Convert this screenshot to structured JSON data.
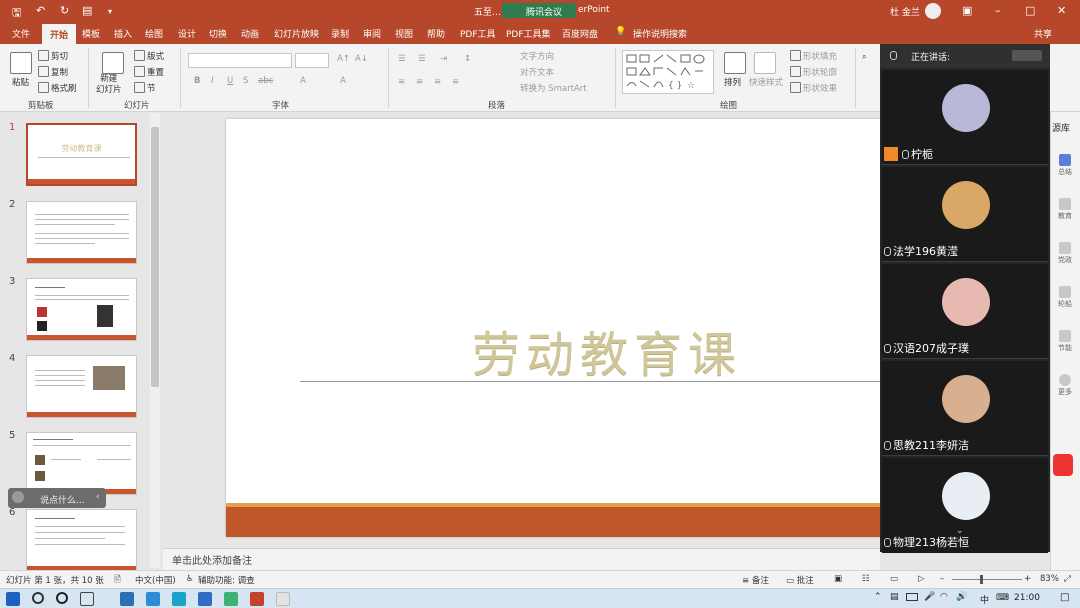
{
  "app": {
    "title": "五至…",
    "title_suffix": "erPoint",
    "meeting_app": "腾讯会议",
    "user_name": "杜 金兰",
    "share_label": "共享"
  },
  "tabs": [
    "文件",
    "开始",
    "模板",
    "插入",
    "绘图",
    "设计",
    "切换",
    "动画",
    "幻灯片放映",
    "录制",
    "审阅",
    "视图",
    "帮助",
    "PDF工具",
    "PDF工具集",
    "百度网盘"
  ],
  "active_tab": "开始",
  "search_label": "操作说明搜索",
  "ribbon": {
    "clipboard": {
      "paste": "粘贴",
      "cut": "剪切",
      "copy": "复制",
      "format_painter": "格式刷",
      "group": "剪贴板"
    },
    "slides": {
      "new_slide": "新建\n幻灯片",
      "layout": "版式",
      "reset": "重置",
      "section": "节",
      "group": "幻灯片"
    },
    "font": {
      "group": "字体",
      "bold": "B",
      "italic": "I",
      "underline": "U",
      "shadow": "S",
      "strike": "abc"
    },
    "paragraph": {
      "group": "段落",
      "text_direction": "文字方向",
      "align_text": "对齐文本",
      "smartart": "转换为 SmartArt"
    },
    "drawing": {
      "group": "绘图",
      "arrange": "排列",
      "quick_styles": "快速样式",
      "shape_fill": "形状填充",
      "shape_outline": "形状轮廓",
      "shape_effects": "形状效果"
    }
  },
  "meeting": {
    "speaking_label": "正在讲话:",
    "participants": [
      {
        "name": "柠栀",
        "color": "#b8b8d8"
      },
      {
        "name": "法学196黄滢",
        "color": "#d9a866"
      },
      {
        "name": "汉语207成子璞",
        "color": "#e7b9b1"
      },
      {
        "name": "思教211李妍洁",
        "color": "#d8b090"
      },
      {
        "name": "物理213杨若恒",
        "color": "#e9eef5"
      }
    ]
  },
  "slides_panel": {
    "numbers": [
      "1",
      "2",
      "3",
      "4",
      "5",
      "6"
    ],
    "thumb1_title": "劳动教育课"
  },
  "slide": {
    "title": "劳动教育课"
  },
  "notes_placeholder": "单击此处添加备注",
  "chat_placeholder": "说点什么...",
  "status": {
    "slide_info": "幻灯片 第 1 张，共 10 张",
    "language": "中文(中国)",
    "accessibility": "辅助功能: 调查",
    "notes": "备注",
    "comments": "批注",
    "zoom": "83%"
  },
  "right_strip": [
    "源库",
    "总结",
    "教育",
    "党政",
    "轮船",
    "节能",
    "更多"
  ],
  "taskbar": {
    "time": "21:00",
    "lang": "中"
  }
}
